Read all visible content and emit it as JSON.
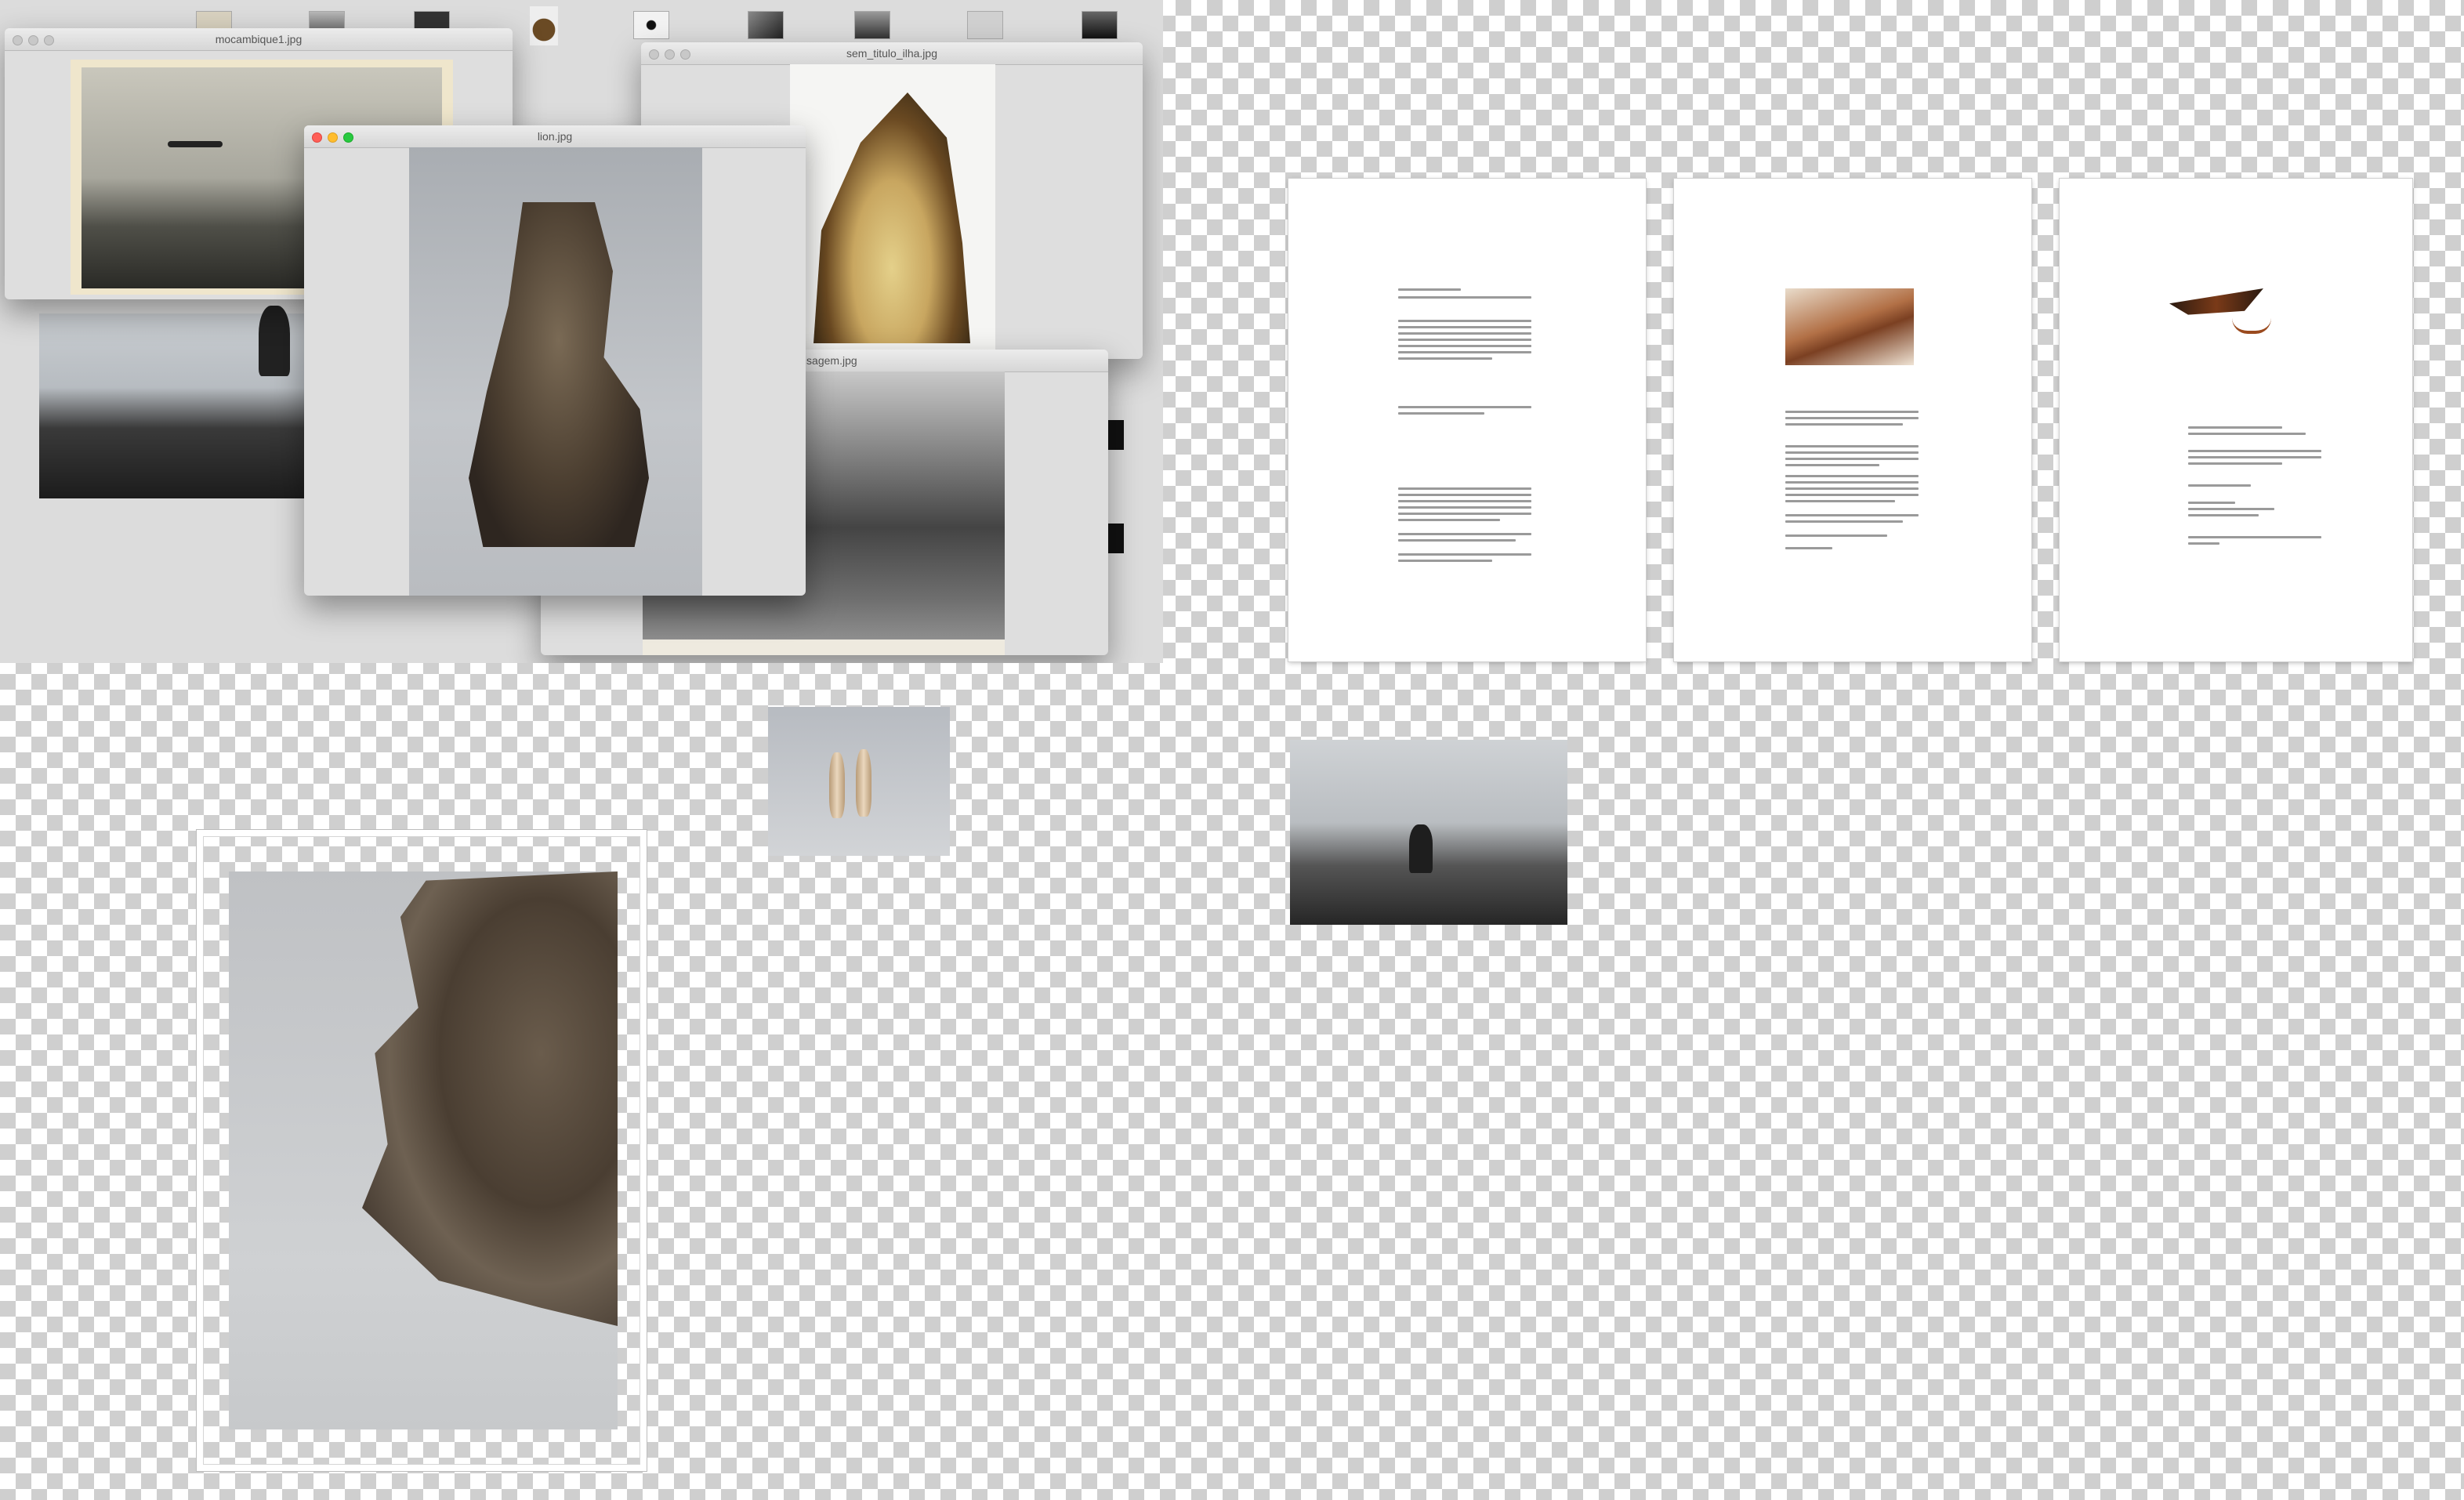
{
  "windows": {
    "back_left": {
      "title": "mocambique1.jpg"
    },
    "back_right": {
      "title": "sem_titulo_ilha.jpg"
    },
    "lower_right": {
      "title": "paisagem.jpg"
    },
    "front": {
      "title": "lion.jpg"
    }
  },
  "colors": {
    "desktop": "#dcdcdc",
    "checker": "#cfcfcf",
    "close": "#ff5f57",
    "minimize": "#ffbd2e",
    "zoom": "#28c940"
  },
  "icons": {
    "close": "circle-red",
    "minimize": "circle-yellow",
    "zoom": "circle-green"
  }
}
